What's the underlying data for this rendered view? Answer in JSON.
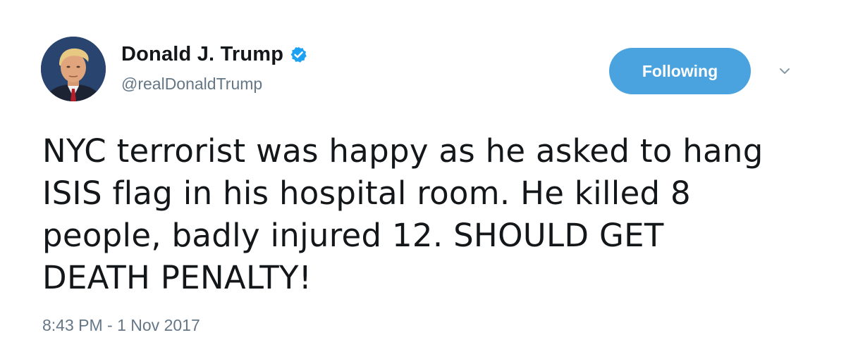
{
  "user": {
    "display_name": "Donald J. Trump",
    "handle": "@realDonaldTrump",
    "verified": true,
    "avatar_icon": "profile-photo"
  },
  "actions": {
    "follow_label": "Following",
    "more_icon": "chevron-down-icon"
  },
  "tweet": {
    "text": "NYC terrorist was happy as he asked to hang\nISIS flag in his hospital room. He killed 8\npeople, badly injured 12. SHOULD GET\nDEATH PENALTY!",
    "timestamp": "8:43 PM - 1 Nov 2017"
  },
  "colors": {
    "accent": "#1da1f2",
    "follow_button": "#4aa3df",
    "secondary_text": "#657786",
    "primary_text": "#14171a"
  }
}
